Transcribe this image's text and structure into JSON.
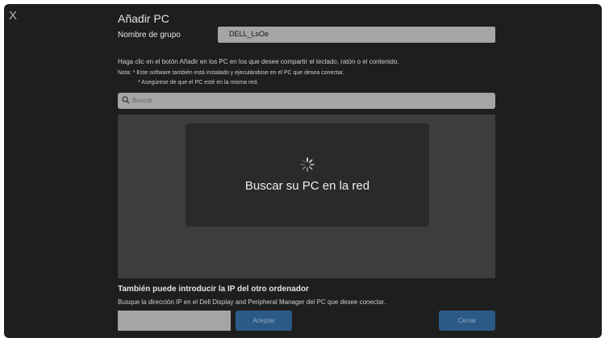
{
  "window": {
    "close_label": "X",
    "title": "Añadir PC"
  },
  "group": {
    "label": "Nombre de grupo",
    "value": "DELL_LsOe"
  },
  "instructions": {
    "main": "Haga clic en el botón Añadir en los PC en los que desee compartir el teclado, ratón o el contenido.",
    "note1": "Nota:  * Este software también está instalado y ejecutándose en el PC que desea conectar.",
    "note2": "* Asegúrese de que el PC esté en la misma red."
  },
  "search": {
    "placeholder": "Buscar",
    "icon": "search-icon"
  },
  "results": {
    "loading_text": "Buscar su PC en la red",
    "icon": "spinner-icon"
  },
  "manual_ip": {
    "heading": "También puede introducir la IP del otro ordenador",
    "description": "Busque la dirección IP en el Dell Display and Peripheral Manager del PC que desee conectar.",
    "value": "",
    "accept_label": "Aceptar"
  },
  "footer": {
    "close_label": "Cerrar"
  },
  "colors": {
    "background": "#1e1e1e",
    "input_bg": "#a5a5a5",
    "button_bg": "#2c5a86",
    "button_text": "#8fa8c0",
    "results_bg": "#3d3d3d",
    "card_bg": "#2a2a2a"
  }
}
